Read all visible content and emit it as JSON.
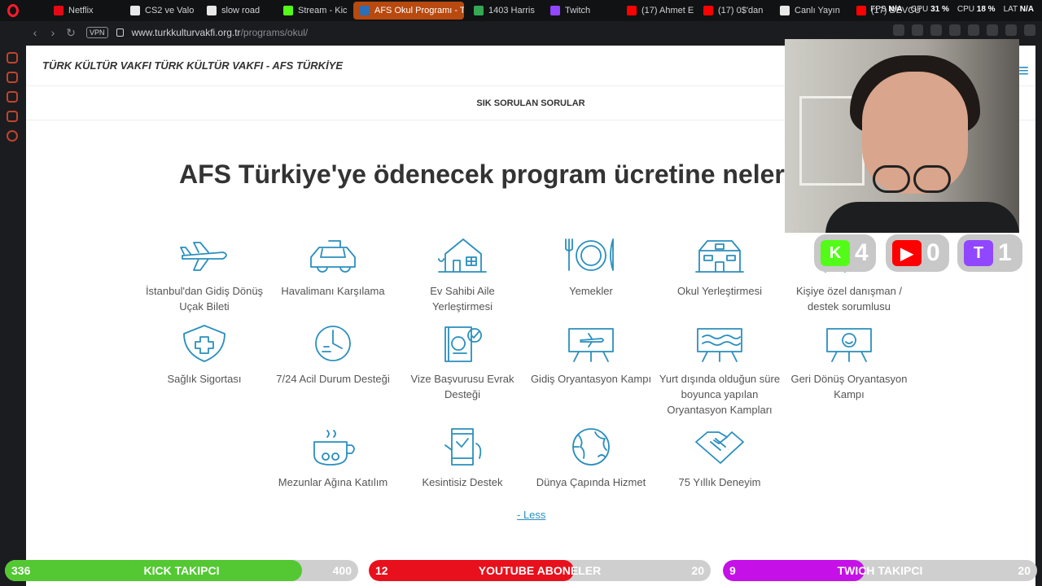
{
  "browser": {
    "tabs": [
      {
        "label": "Netflix",
        "color": "#e50914"
      },
      {
        "label": "CS2 ve Valo",
        "color": "#e8e8e8"
      },
      {
        "label": "slow road",
        "color": "#e8e8e8"
      },
      {
        "label": "Stream - Kic",
        "color": "#53fc18"
      },
      {
        "label": "AFS Okul Programı - T",
        "color": "#2a6fb7"
      },
      {
        "label": "1403 Harris",
        "color": "#34a853"
      },
      {
        "label": "Twitch",
        "color": "#9146ff"
      },
      {
        "label": "(17) Ahmet E",
        "color": "#ff0000"
      },
      {
        "label": "(17) 0$'dan",
        "color": "#ff0000"
      },
      {
        "label": "Canlı Yayın",
        "color": "#e8e8e8"
      },
      {
        "label": "(17) DEVCU",
        "color": "#ff0000"
      }
    ],
    "active_tab_index": 4,
    "stats": {
      "fps_label": "FPS",
      "fps": "N/A",
      "gpu_label": "GPU",
      "gpu": "31 %",
      "cpu_label": "CPU",
      "cpu": "18 %",
      "lat_label": "LAT",
      "lat": "N/A"
    },
    "vpn_label": "VPN",
    "url_host": "www.turkkulturvakfi.org.tr",
    "url_path": "/programs/okul/"
  },
  "site": {
    "brand": "TÜRK KÜLTÜR VAKFI TÜRK KÜLTÜR VAKFI - AFS TÜRKİYE",
    "subnav": "SIK SORULAN SORULAR",
    "headline": "AFS Türkiye'ye ödenecek program ücretine neler d",
    "features": [
      "İstanbul'dan Gidiş Dönüş Uçak Bileti",
      "Havalimanı Karşılama",
      "Ev Sahibi Aile Yerleştirmesi",
      "Yemekler",
      "Okul Yerleştirmesi",
      "Kişiye özel danışman / destek sorumlusu",
      "Sağlık Sigortası",
      "7/24 Acil Durum Desteği",
      "Vize Başvurusu Evrak Desteği",
      "Gidiş Oryantasyon Kampı",
      "Yurt dışında olduğun süre boyunca yapılan Oryantasyon Kampları",
      "Geri Dönüş Oryantasyon Kampı",
      "Mezunlar Ağına Katılım",
      "Kesintisiz Destek",
      "Dünya Çapında Hizmet",
      "75 Yıllık Deneyim"
    ],
    "less_link": "- Less",
    "icons": [
      "airplane-icon",
      "car-icon",
      "house-icon",
      "plate-icon",
      "school-icon",
      "advisor-icon",
      "shield-cross-icon",
      "clock-24-icon",
      "passport-icon",
      "board-plane-icon",
      "board-wave-icon",
      "board-face-icon",
      "mug-icon",
      "phone-icon",
      "globe-icon",
      "handshake-icon"
    ],
    "accent": "#2a8fbd"
  },
  "overlay": {
    "counters": [
      {
        "name": "kick",
        "logo": "K",
        "value": "4",
        "color": "#53fc18"
      },
      {
        "name": "youtube",
        "logo": "▶",
        "value": "0",
        "color": "#ff0000"
      },
      {
        "name": "twitch",
        "logo": "T",
        "value": "1",
        "color": "#9146ff"
      }
    ],
    "goals": [
      {
        "name": "kick",
        "current": "336",
        "title": "KICK TAKIPCI",
        "max": "400",
        "fraction": 0.84,
        "color": "#53c832"
      },
      {
        "name": "youtube",
        "current": "12",
        "title": "YOUTUBE ABONELER",
        "max": "20",
        "fraction": 0.6,
        "color": "#e8101c"
      },
      {
        "name": "twitch",
        "current": "9",
        "title": "TWICH TAKIPCI",
        "max": "20",
        "fraction": 0.45,
        "color": "#c610e8"
      }
    ]
  }
}
